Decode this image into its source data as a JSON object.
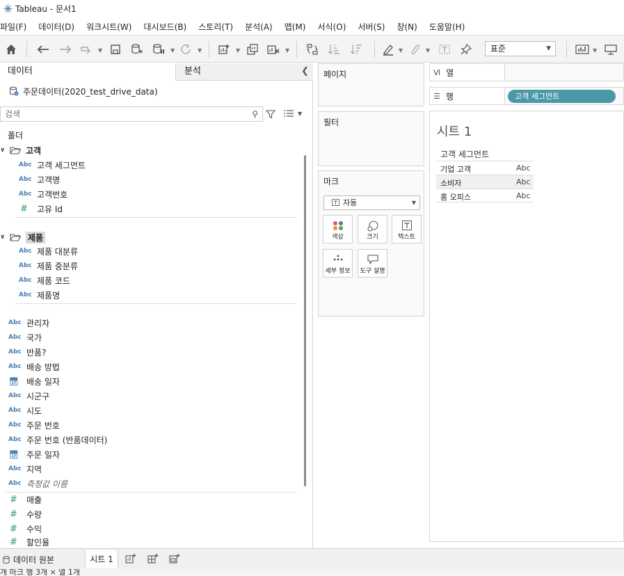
{
  "window": {
    "title": "Tableau - 문서1"
  },
  "menu": [
    "파일(F)",
    "데이터(D)",
    "워크시트(W)",
    "대시보드(B)",
    "스토리(T)",
    "분석(A)",
    "맵(M)",
    "서식(O)",
    "서버(S)",
    "창(N)",
    "도움말(H)"
  ],
  "toolbar": {
    "fit_value": "표준"
  },
  "data_panel": {
    "tab_data": "데이터",
    "tab_analysis": "분석",
    "datasource": "주문데이터(2020_test_drive_data)",
    "search_placeholder": "검색",
    "folders_label": "폴더",
    "group_customer": {
      "name": "고객",
      "fields": [
        {
          "type": "Abc",
          "name": "고객 세그먼트"
        },
        {
          "type": "Abc",
          "name": "고객명"
        },
        {
          "type": "Abc",
          "name": "고객번호"
        },
        {
          "type": "#",
          "name": "고유 Id"
        }
      ]
    },
    "group_product": {
      "name": "제품",
      "fields": [
        {
          "type": "Abc",
          "name": "제품 대분류"
        },
        {
          "type": "Abc",
          "name": "제품 중분류"
        },
        {
          "type": "Abc",
          "name": "제품 코드"
        },
        {
          "type": "Abc",
          "name": "제품명"
        }
      ]
    },
    "dimensions": [
      {
        "type": "Abc",
        "name": "관리자"
      },
      {
        "type": "Abc",
        "name": "국가"
      },
      {
        "type": "Abc",
        "name": "반품?"
      },
      {
        "type": "Abc",
        "name": "배송 방법"
      },
      {
        "type": "cal",
        "name": "배송 일자"
      },
      {
        "type": "Abc",
        "name": "시군구"
      },
      {
        "type": "Abc",
        "name": "시도"
      },
      {
        "type": "Abc",
        "name": "주문 번호"
      },
      {
        "type": "Abc",
        "name": "주문 번호 (반품데이터)"
      },
      {
        "type": "cal",
        "name": "주문 일자"
      },
      {
        "type": "Abc",
        "name": "지역"
      },
      {
        "type": "Abc",
        "name": "측정값 이름"
      }
    ],
    "measures": [
      {
        "type": "#",
        "name": "매출"
      },
      {
        "type": "#",
        "name": "수량"
      },
      {
        "type": "#",
        "name": "수익"
      },
      {
        "type": "#",
        "name": "할인율"
      }
    ]
  },
  "cards": {
    "pages": "페이지",
    "filters": "필터",
    "marks": "마크",
    "mark_type": "자동",
    "mark_buttons": {
      "color": "색상",
      "size": "크기",
      "text": "텍스트",
      "detail": "세부 정보",
      "tooltip": "도구 설명"
    }
  },
  "shelves": {
    "columns_label": "열",
    "rows_label": "행",
    "rows_pill": "고객 세그먼트"
  },
  "view": {
    "sheet_title": "시트 1",
    "column_header": "고객 세그먼트",
    "rows": [
      {
        "label": "기업 고객",
        "value": "Abc"
      },
      {
        "label": "소비자",
        "value": "Abc"
      },
      {
        "label": "홈 오피스",
        "value": "Abc"
      }
    ]
  },
  "bottom": {
    "datasource_tab": "데이터 원본",
    "sheet_tab": "시트 1"
  },
  "status": "개 마크   행 3개 × 열 1개"
}
